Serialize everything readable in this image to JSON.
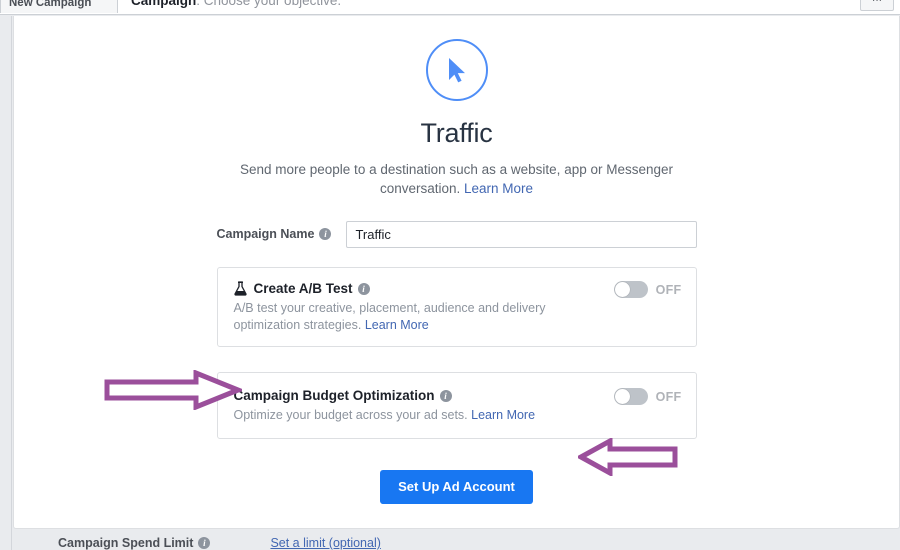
{
  "topbar": {
    "tab_label": "New Campaign",
    "heading_bold": "Campaign",
    "heading_rest": ": Choose your objective.",
    "right_button_label": "···"
  },
  "objective": {
    "icon_name": "cursor-arrow-icon",
    "title": "Traffic",
    "description": "Send more people to a destination such as a website, app or Messenger conversation.",
    "learn_more": "Learn More"
  },
  "campaign_name": {
    "label": "Campaign Name",
    "info_glyph": "i",
    "value": "Traffic",
    "placeholder": "Campaign Name"
  },
  "ab_test": {
    "icon_name": "flask-icon",
    "title": "Create A/B Test",
    "info_glyph": "i",
    "description": "A/B test your creative, placement, audience and delivery optimization strategies.",
    "learn_more": "Learn More",
    "toggle_state": "OFF"
  },
  "budget_optimization": {
    "title": "Campaign Budget Optimization",
    "info_glyph": "i",
    "description": "Optimize your budget across your ad sets.",
    "learn_more": "Learn More",
    "toggle_state": "OFF"
  },
  "primary_action": {
    "label": "Set Up Ad Account"
  },
  "spend_limit": {
    "label": "Campaign Spend Limit",
    "info_glyph": "i",
    "link": "Set a limit (optional)"
  },
  "annotations": [
    {
      "name": "arrow-pointing-to-campaign-budget-optimization",
      "direction": "right",
      "color": "#9b4f9b"
    },
    {
      "name": "arrow-pointing-to-set-up-ad-account",
      "direction": "left",
      "color": "#9b4f9b"
    }
  ],
  "colors": {
    "accent_blue": "#1877f2",
    "icon_blue": "#4f8ef7",
    "link_blue": "#4267b2",
    "annotation_purple": "#9b4f9b",
    "page_bg": "#e9ebee",
    "panel_bg": "#ffffff"
  }
}
